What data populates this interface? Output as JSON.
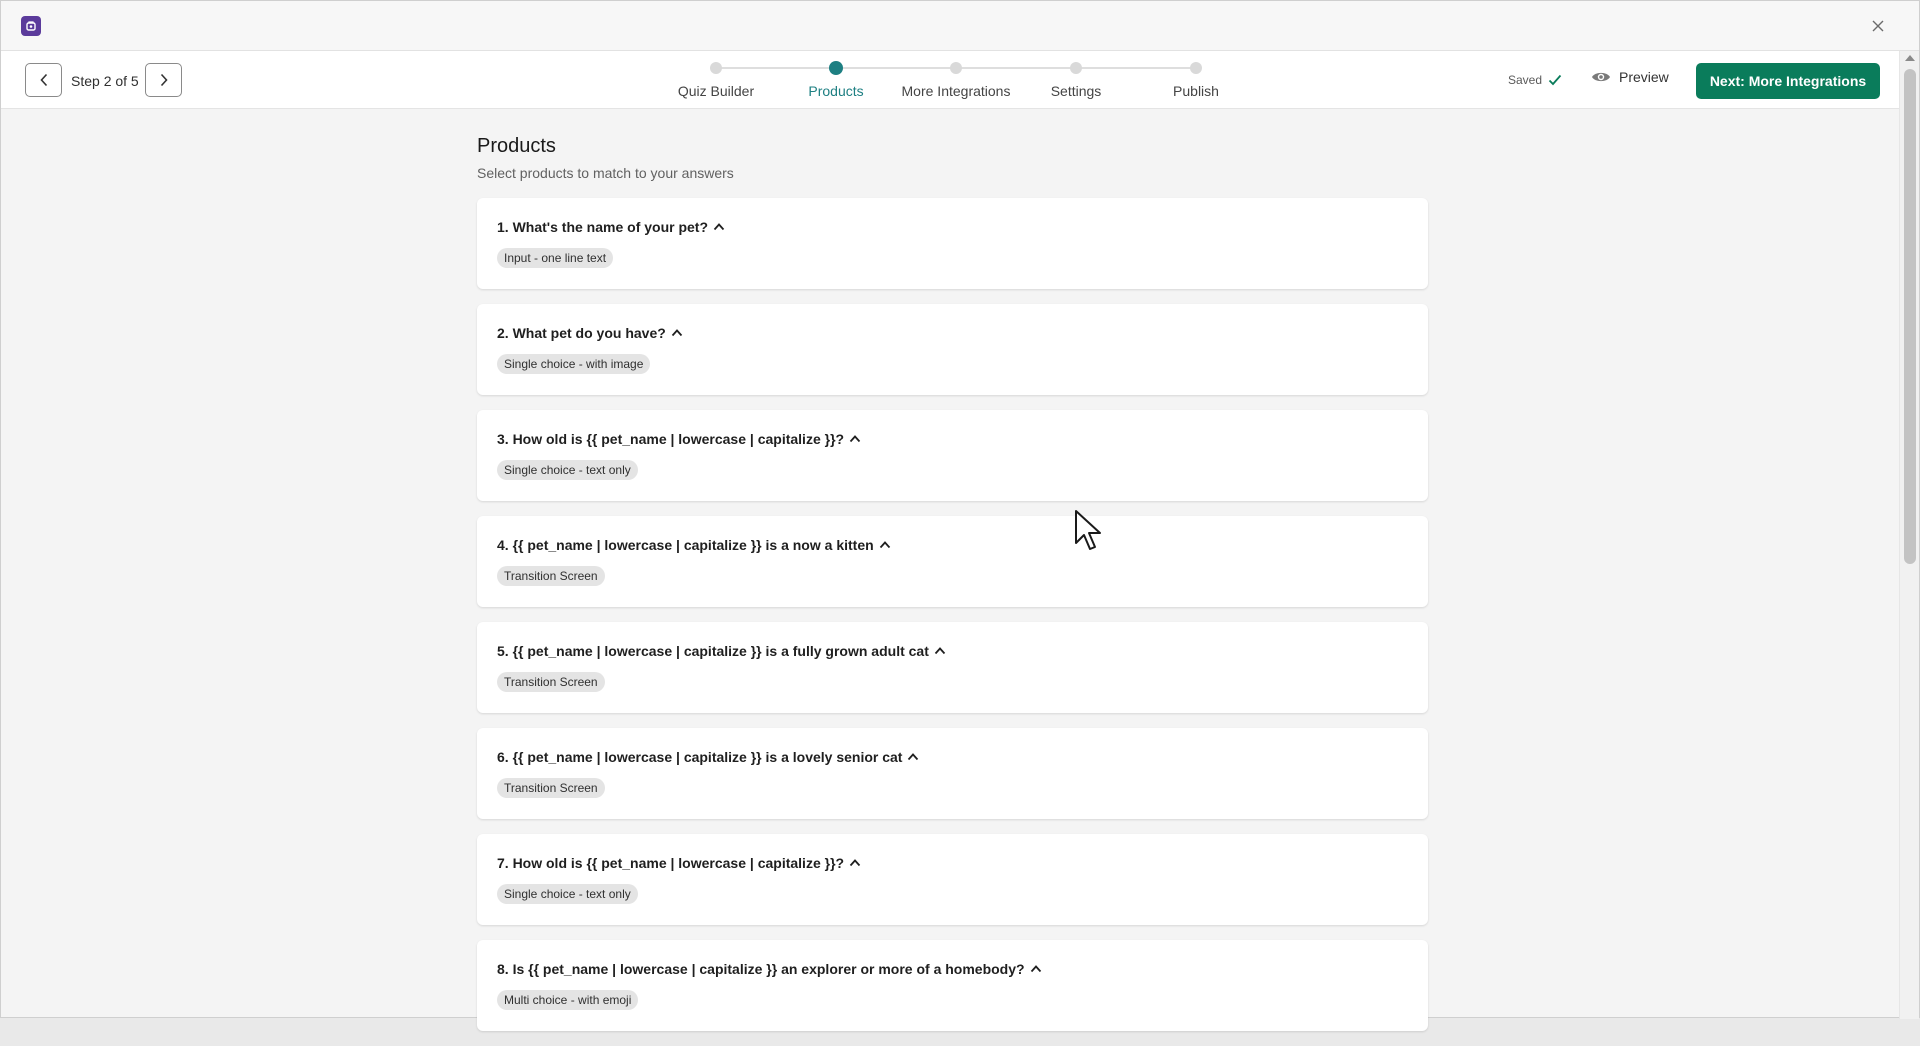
{
  "toolbar": {
    "step_label": "Step 2 of 5",
    "saved_label": "Saved",
    "preview_label": "Preview",
    "next_label": "Next: More Integrations"
  },
  "stepper": {
    "steps": [
      {
        "label": "Quiz Builder",
        "active": false
      },
      {
        "label": "Products",
        "active": true
      },
      {
        "label": "More Integrations",
        "active": false
      },
      {
        "label": "Settings",
        "active": false
      },
      {
        "label": "Publish",
        "active": false
      }
    ]
  },
  "page": {
    "title": "Products",
    "subtitle": "Select products to match to your answers"
  },
  "questions": [
    {
      "title": "1. What's the name of your pet?",
      "tag": "Input - one line text"
    },
    {
      "title": "2. What pet do you have?",
      "tag": "Single choice - with image"
    },
    {
      "title": "3. How old is {{ pet_name | lowercase | capitalize }}?",
      "tag": "Single choice - text only"
    },
    {
      "title": "4. {{ pet_name | lowercase | capitalize }} is a now a kitten",
      "tag": "Transition Screen"
    },
    {
      "title": "5. {{ pet_name | lowercase | capitalize }} is a fully grown adult cat",
      "tag": "Transition Screen"
    },
    {
      "title": "6. {{ pet_name | lowercase | capitalize }} is a lovely senior cat",
      "tag": "Transition Screen"
    },
    {
      "title": "7. How old is {{ pet_name | lowercase | capitalize }}?",
      "tag": "Single choice - text only"
    },
    {
      "title": "8. Is {{ pet_name | lowercase | capitalize }} an explorer or more of a homebody?",
      "tag": "Multi choice - with emoji"
    }
  ],
  "colors": {
    "accent": "#1d7f82",
    "primary_button": "#0a7c5b",
    "app_icon": "#5b3b9b"
  },
  "icons": {
    "app": "app-logo-icon",
    "close": "close-icon",
    "prev": "chevron-left-icon",
    "next": "chevron-right-icon",
    "saved": "check-icon",
    "preview": "eye-icon",
    "collapse": "chevron-up-icon"
  }
}
